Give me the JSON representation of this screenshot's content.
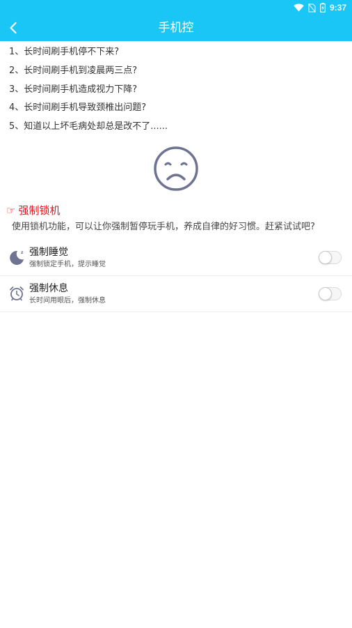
{
  "status_bar": {
    "time": "9:37",
    "icons": [
      "wifi-icon",
      "no-sim-icon",
      "battery-icon"
    ]
  },
  "toolbar": {
    "title": "手机控",
    "back_icon": "chevron-left-icon"
  },
  "questions": [
    "1、长时间刷手机停不下来?",
    "2、长时间刷手机到凌晨两三点?",
    "3、长时间刷手机造成视力下降?",
    "4、长时间刷手机导致颈椎出问题?",
    "5、知道以上坏毛病处却总是改不了......"
  ],
  "section": {
    "hand_glyph": "☞",
    "title": "强制锁机",
    "description": "使用锁机功能，可以让你强制暂停玩手机，养成自律的好习惯。赶紧试试吧?"
  },
  "items": [
    {
      "icon": "moon-sleep-icon",
      "label": "强制睡觉",
      "sub": "强制锁定手机，提示睡觉",
      "enabled": false
    },
    {
      "icon": "alarm-clock-icon",
      "label": "强制休息",
      "sub": "长时间用眼后，强制休息",
      "enabled": false
    }
  ],
  "colors": {
    "accent": "#1ac6f5",
    "section_title": "#e8111a",
    "icon": "#6e7391"
  }
}
